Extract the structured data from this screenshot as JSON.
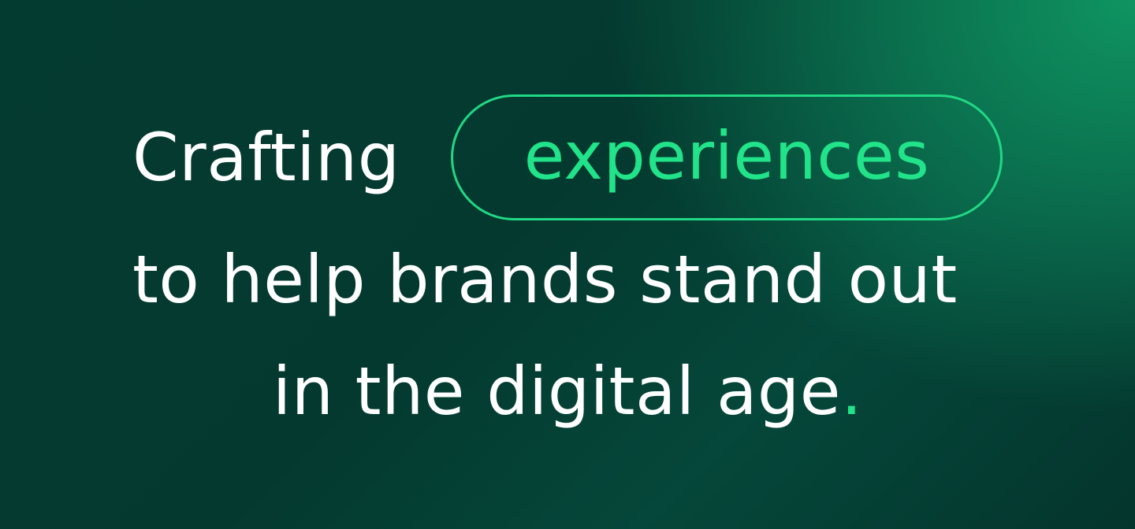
{
  "hero": {
    "line1_lead": "Crafting",
    "highlight": "experiences",
    "line2": "to help brands stand out",
    "line3": "in the digital age",
    "period": "."
  },
  "colors": {
    "accent": "#21e389",
    "text": "#ffffff",
    "background_dark": "#04392f",
    "background_light": "#0f9461"
  }
}
